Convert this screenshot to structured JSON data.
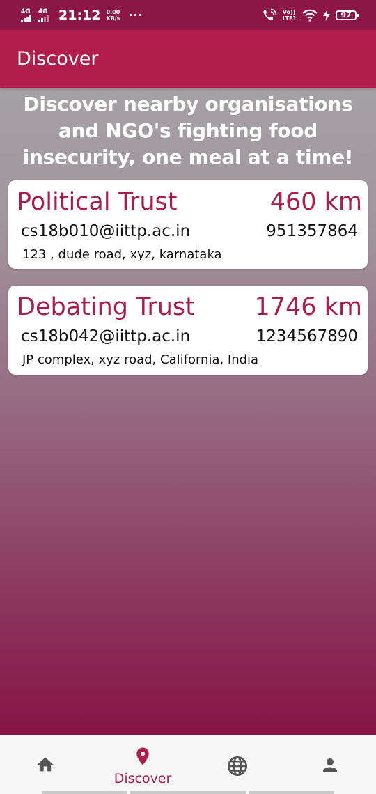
{
  "status_bar": {
    "network_1": "4G",
    "network_2": "4G",
    "time": "21:12",
    "speed_value": "0.00",
    "speed_unit": "KB/s",
    "more": "···",
    "volte_top": "Vo))",
    "volte_bottom": "LTE1",
    "battery": "97"
  },
  "app_bar": {
    "title": "Discover"
  },
  "tagline": "Discover nearby organisations and NGO's fighting food insecurity, one meal at a time!",
  "organisations": [
    {
      "name": "Political Trust",
      "distance": "460 km",
      "email": "cs18b010@iittp.ac.in",
      "phone": "951357864",
      "address": "123 , dude road,  xyz,  karnataka"
    },
    {
      "name": "Debating Trust",
      "distance": "1746 km",
      "email": "cs18b042@iittp.ac.in",
      "phone": "1234567890",
      "address": "JP complex,  xyz road,  California,  India"
    }
  ],
  "bottom_nav": {
    "items": [
      {
        "icon": "home-icon",
        "label": ""
      },
      {
        "icon": "location-pin-icon",
        "label": "Discover"
      },
      {
        "icon": "globe-icon",
        "label": ""
      },
      {
        "icon": "person-icon",
        "label": ""
      }
    ],
    "active_index": 1
  },
  "colors": {
    "status_bar": "#8c1747",
    "app_bar": "#b11d4c",
    "accent": "#a81f4e",
    "inactive_icon": "#555555"
  }
}
